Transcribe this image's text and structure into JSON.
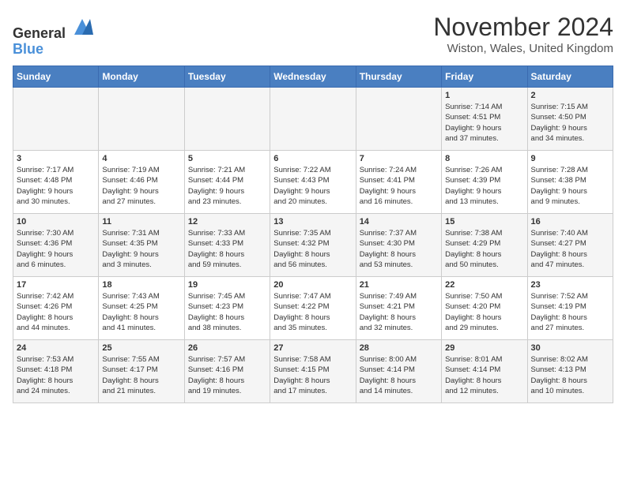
{
  "header": {
    "logo_general": "General",
    "logo_blue": "Blue",
    "month_title": "November 2024",
    "location": "Wiston, Wales, United Kingdom"
  },
  "weekdays": [
    "Sunday",
    "Monday",
    "Tuesday",
    "Wednesday",
    "Thursday",
    "Friday",
    "Saturday"
  ],
  "weeks": [
    [
      {
        "day": "",
        "info": ""
      },
      {
        "day": "",
        "info": ""
      },
      {
        "day": "",
        "info": ""
      },
      {
        "day": "",
        "info": ""
      },
      {
        "day": "",
        "info": ""
      },
      {
        "day": "1",
        "info": "Sunrise: 7:14 AM\nSunset: 4:51 PM\nDaylight: 9 hours\nand 37 minutes."
      },
      {
        "day": "2",
        "info": "Sunrise: 7:15 AM\nSunset: 4:50 PM\nDaylight: 9 hours\nand 34 minutes."
      }
    ],
    [
      {
        "day": "3",
        "info": "Sunrise: 7:17 AM\nSunset: 4:48 PM\nDaylight: 9 hours\nand 30 minutes."
      },
      {
        "day": "4",
        "info": "Sunrise: 7:19 AM\nSunset: 4:46 PM\nDaylight: 9 hours\nand 27 minutes."
      },
      {
        "day": "5",
        "info": "Sunrise: 7:21 AM\nSunset: 4:44 PM\nDaylight: 9 hours\nand 23 minutes."
      },
      {
        "day": "6",
        "info": "Sunrise: 7:22 AM\nSunset: 4:43 PM\nDaylight: 9 hours\nand 20 minutes."
      },
      {
        "day": "7",
        "info": "Sunrise: 7:24 AM\nSunset: 4:41 PM\nDaylight: 9 hours\nand 16 minutes."
      },
      {
        "day": "8",
        "info": "Sunrise: 7:26 AM\nSunset: 4:39 PM\nDaylight: 9 hours\nand 13 minutes."
      },
      {
        "day": "9",
        "info": "Sunrise: 7:28 AM\nSunset: 4:38 PM\nDaylight: 9 hours\nand 9 minutes."
      }
    ],
    [
      {
        "day": "10",
        "info": "Sunrise: 7:30 AM\nSunset: 4:36 PM\nDaylight: 9 hours\nand 6 minutes."
      },
      {
        "day": "11",
        "info": "Sunrise: 7:31 AM\nSunset: 4:35 PM\nDaylight: 9 hours\nand 3 minutes."
      },
      {
        "day": "12",
        "info": "Sunrise: 7:33 AM\nSunset: 4:33 PM\nDaylight: 8 hours\nand 59 minutes."
      },
      {
        "day": "13",
        "info": "Sunrise: 7:35 AM\nSunset: 4:32 PM\nDaylight: 8 hours\nand 56 minutes."
      },
      {
        "day": "14",
        "info": "Sunrise: 7:37 AM\nSunset: 4:30 PM\nDaylight: 8 hours\nand 53 minutes."
      },
      {
        "day": "15",
        "info": "Sunrise: 7:38 AM\nSunset: 4:29 PM\nDaylight: 8 hours\nand 50 minutes."
      },
      {
        "day": "16",
        "info": "Sunrise: 7:40 AM\nSunset: 4:27 PM\nDaylight: 8 hours\nand 47 minutes."
      }
    ],
    [
      {
        "day": "17",
        "info": "Sunrise: 7:42 AM\nSunset: 4:26 PM\nDaylight: 8 hours\nand 44 minutes."
      },
      {
        "day": "18",
        "info": "Sunrise: 7:43 AM\nSunset: 4:25 PM\nDaylight: 8 hours\nand 41 minutes."
      },
      {
        "day": "19",
        "info": "Sunrise: 7:45 AM\nSunset: 4:23 PM\nDaylight: 8 hours\nand 38 minutes."
      },
      {
        "day": "20",
        "info": "Sunrise: 7:47 AM\nSunset: 4:22 PM\nDaylight: 8 hours\nand 35 minutes."
      },
      {
        "day": "21",
        "info": "Sunrise: 7:49 AM\nSunset: 4:21 PM\nDaylight: 8 hours\nand 32 minutes."
      },
      {
        "day": "22",
        "info": "Sunrise: 7:50 AM\nSunset: 4:20 PM\nDaylight: 8 hours\nand 29 minutes."
      },
      {
        "day": "23",
        "info": "Sunrise: 7:52 AM\nSunset: 4:19 PM\nDaylight: 8 hours\nand 27 minutes."
      }
    ],
    [
      {
        "day": "24",
        "info": "Sunrise: 7:53 AM\nSunset: 4:18 PM\nDaylight: 8 hours\nand 24 minutes."
      },
      {
        "day": "25",
        "info": "Sunrise: 7:55 AM\nSunset: 4:17 PM\nDaylight: 8 hours\nand 21 minutes."
      },
      {
        "day": "26",
        "info": "Sunrise: 7:57 AM\nSunset: 4:16 PM\nDaylight: 8 hours\nand 19 minutes."
      },
      {
        "day": "27",
        "info": "Sunrise: 7:58 AM\nSunset: 4:15 PM\nDaylight: 8 hours\nand 17 minutes."
      },
      {
        "day": "28",
        "info": "Sunrise: 8:00 AM\nSunset: 4:14 PM\nDaylight: 8 hours\nand 14 minutes."
      },
      {
        "day": "29",
        "info": "Sunrise: 8:01 AM\nSunset: 4:14 PM\nDaylight: 8 hours\nand 12 minutes."
      },
      {
        "day": "30",
        "info": "Sunrise: 8:02 AM\nSunset: 4:13 PM\nDaylight: 8 hours\nand 10 minutes."
      }
    ]
  ]
}
